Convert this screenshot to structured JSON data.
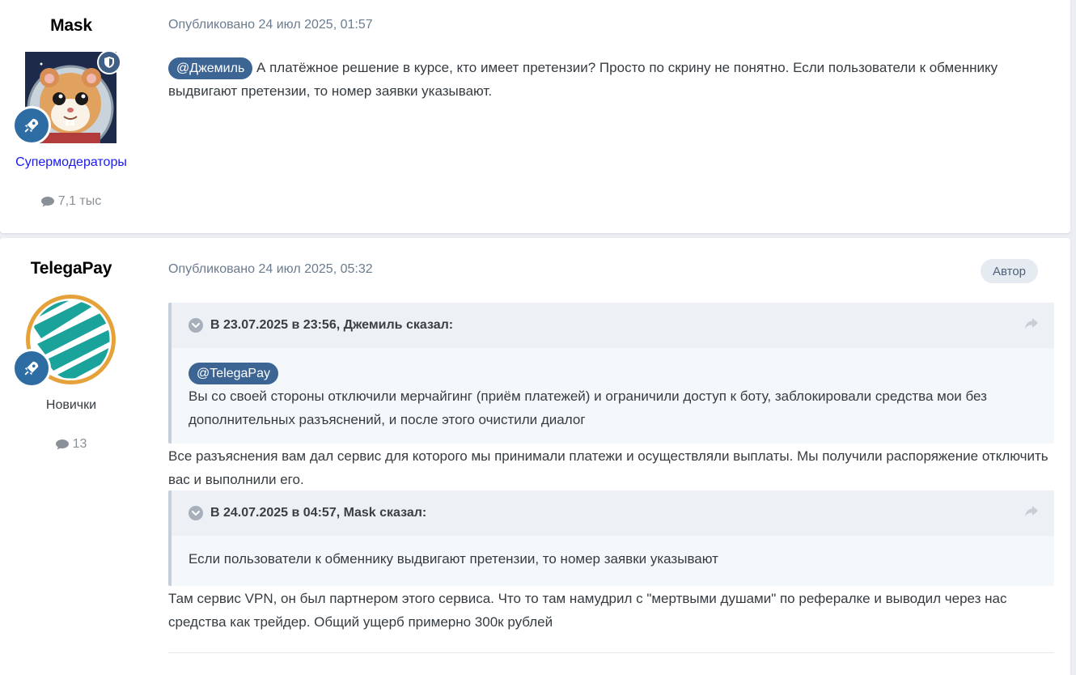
{
  "posts": [
    {
      "author": "Mask",
      "group": "Супермодераторы",
      "group_color": "#1a1aee",
      "post_count": "7,1 тыс",
      "published": "Опубликовано 24 июл 2025, 01:57",
      "mention": "@Джемиль",
      "text": "А платёжное решение в курсе, кто имеет претензии? Просто по скрину не понятно. Если пользователи к обменнику выдвигают претензии, то номер заявки указывают.",
      "icons": [
        "shield-icon",
        "rocket-icon",
        "comment-icon"
      ]
    },
    {
      "author": "TelegaPay",
      "group": "Новички",
      "group_color": "#353c41",
      "post_count": "13",
      "published": "Опубликовано 24 июл 2025, 05:32",
      "author_badge": "Автор",
      "quote1": {
        "header": "В 23.07.2025 в 23:56, Джемиль сказал:",
        "mention": "@TelegaPay",
        "text": "Вы со своей стороны отключили мерчайгинг (приём платежей) и ограничили доступ к боту, заблокировали средства мои без дополнительных разъяснений, и после этого очистили диалог"
      },
      "reply1": "Все разъяснения вам дал сервис для которого мы принимали платежи и осуществляли выплаты. Мы получили распоряжение отключить вас и выполнили его.",
      "quote2": {
        "header": "В 24.07.2025 в 04:57, Mask сказал:",
        "text": "Если пользователи к обменнику выдвигают претензии, то номер заявки указывают"
      },
      "reply2": "Там сервис VPN, он был партнером этого сервиса. Что то там намудрил с \"мертвыми душами\" по рефералке и выводил через нас средства как трейдер. Общий ущерб примерно 300к рублей",
      "icons": [
        "rocket-icon",
        "comment-icon",
        "chevron-down-icon",
        "share-icon"
      ]
    }
  ],
  "colors": {
    "mention_bg": "#3d6594",
    "rank_badge": "#2e6da4",
    "meta_text": "#6c7c8f"
  }
}
